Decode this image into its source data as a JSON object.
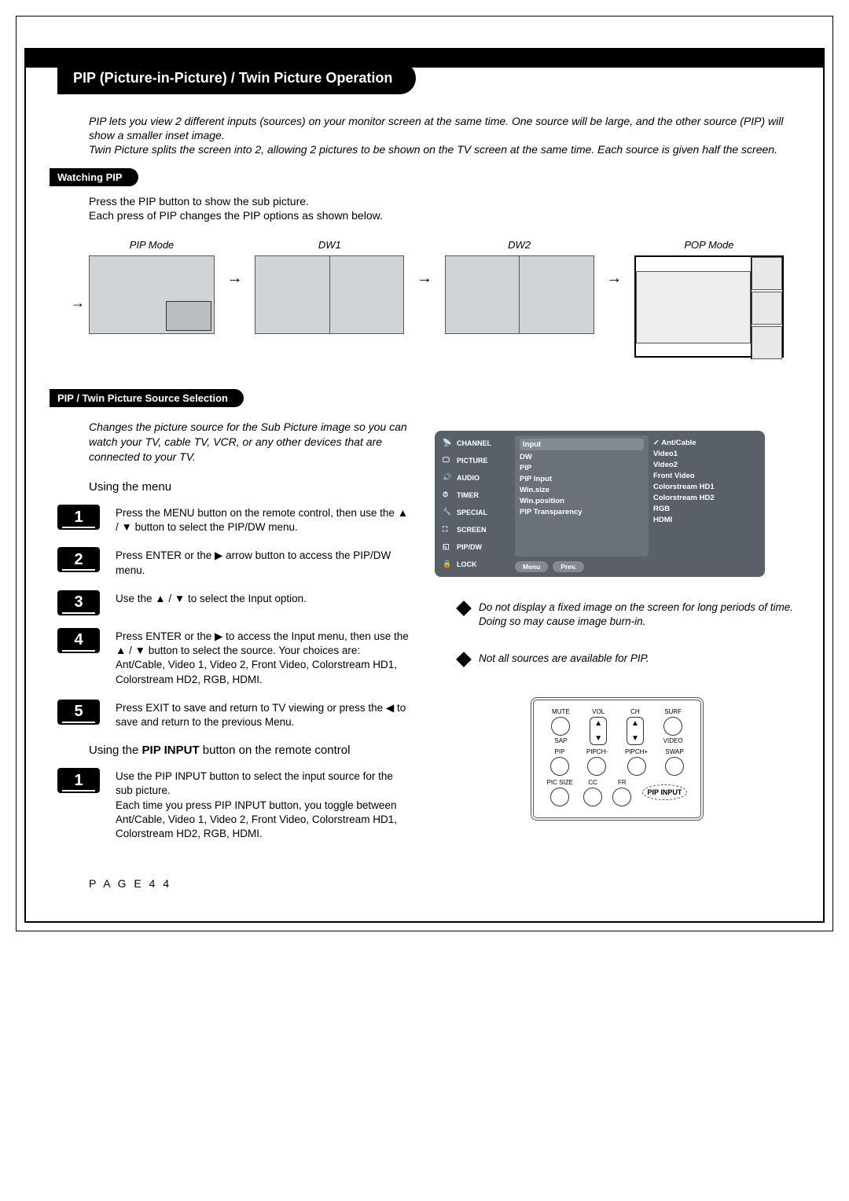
{
  "title": "PIP (Picture-in-Picture) / Twin Picture Operation",
  "intro": "PIP lets you view 2 different inputs (sources) on your monitor screen at the same time. One source will be large, and the other source (PIP) will show a smaller inset image.\nTwin Picture splits the screen into 2, allowing 2 pictures to be shown on the TV screen at the same time. Each source is given half the screen.",
  "watching_pip": {
    "heading": "Watching PIP",
    "desc": "Press the PIP button to show the sub picture.\nEach press of PIP changes the PIP options as shown below.",
    "modes": {
      "pip": "PIP Mode",
      "dw1": "DW1",
      "dw2": "DW2",
      "pop": "POP Mode"
    }
  },
  "source_sel": {
    "heading": "PIP / Twin Picture Source Selection",
    "desc": "Changes the picture source for the Sub Picture image so you can watch your TV, cable TV, VCR, or any other devices that are connected to your TV.",
    "using_menu": "Using the menu",
    "steps": [
      "Press the MENU button on the remote control, then use the ▲ / ▼ button to select the PIP/DW menu.",
      "Press ENTER or the ▶ arrow button to access the PIP/DW menu.",
      "Use the ▲ / ▼ to select the Input option.",
      "Press ENTER or the ▶ to access the Input menu, then use the ▲ / ▼ button to select the source. Your choices are: Ant/Cable, Video 1, Video 2, Front Video, Colorstream HD1, Colorstream HD2, RGB, HDMI.",
      "Press EXIT to save and return to TV viewing or press the ◀ to save and return to the previous Menu."
    ],
    "using_pip_input_head": "Using the PIP INPUT button on the remote control",
    "using_pip_input_step": "Use the PIP INPUT button to select the input source for the sub picture.\nEach time you press PIP INPUT button, you toggle between Ant/Cable, Video 1, Video 2, Front Video, Colorstream HD1, Colorstream HD2, RGB, HDMI."
  },
  "osd": {
    "left_items": [
      "CHANNEL",
      "PICTURE",
      "AUDIO",
      "TIMER",
      "SPECIAL",
      "SCREEN",
      "PIP/DW",
      "LOCK"
    ],
    "center_items": [
      "Input",
      "DW",
      "PIP",
      "PIP Input",
      "Win.size",
      "Win.position",
      "PIP Transparency"
    ],
    "right_items": [
      "Ant/Cable",
      "Video1",
      "Video2",
      "Front Video",
      "Colorstream HD1",
      "Colorstream HD2",
      "RGB",
      "HDMI"
    ],
    "footer": [
      "Menu",
      "Prev."
    ]
  },
  "notes": {
    "n1": "Do not display a fixed image on the screen for long periods of  time. Doing so may cause image burn-in.",
    "n2": "Not all sources are available for PIP."
  },
  "remote": {
    "row1": [
      "MUTE",
      "VOL",
      "CH",
      "SURF"
    ],
    "row1b": [
      "SAP",
      "",
      "",
      "VIDEO"
    ],
    "row2": [
      "PIP",
      "PIPCH-",
      "PIPCH+",
      "SWAP"
    ],
    "row3": [
      "PIC SIZE",
      "CC",
      "FR"
    ],
    "callout": "PIP INPUT"
  },
  "page_number": "P A G E   4 4",
  "step_labels": [
    "1",
    "2",
    "3",
    "4",
    "5"
  ],
  "step1_label": "1"
}
